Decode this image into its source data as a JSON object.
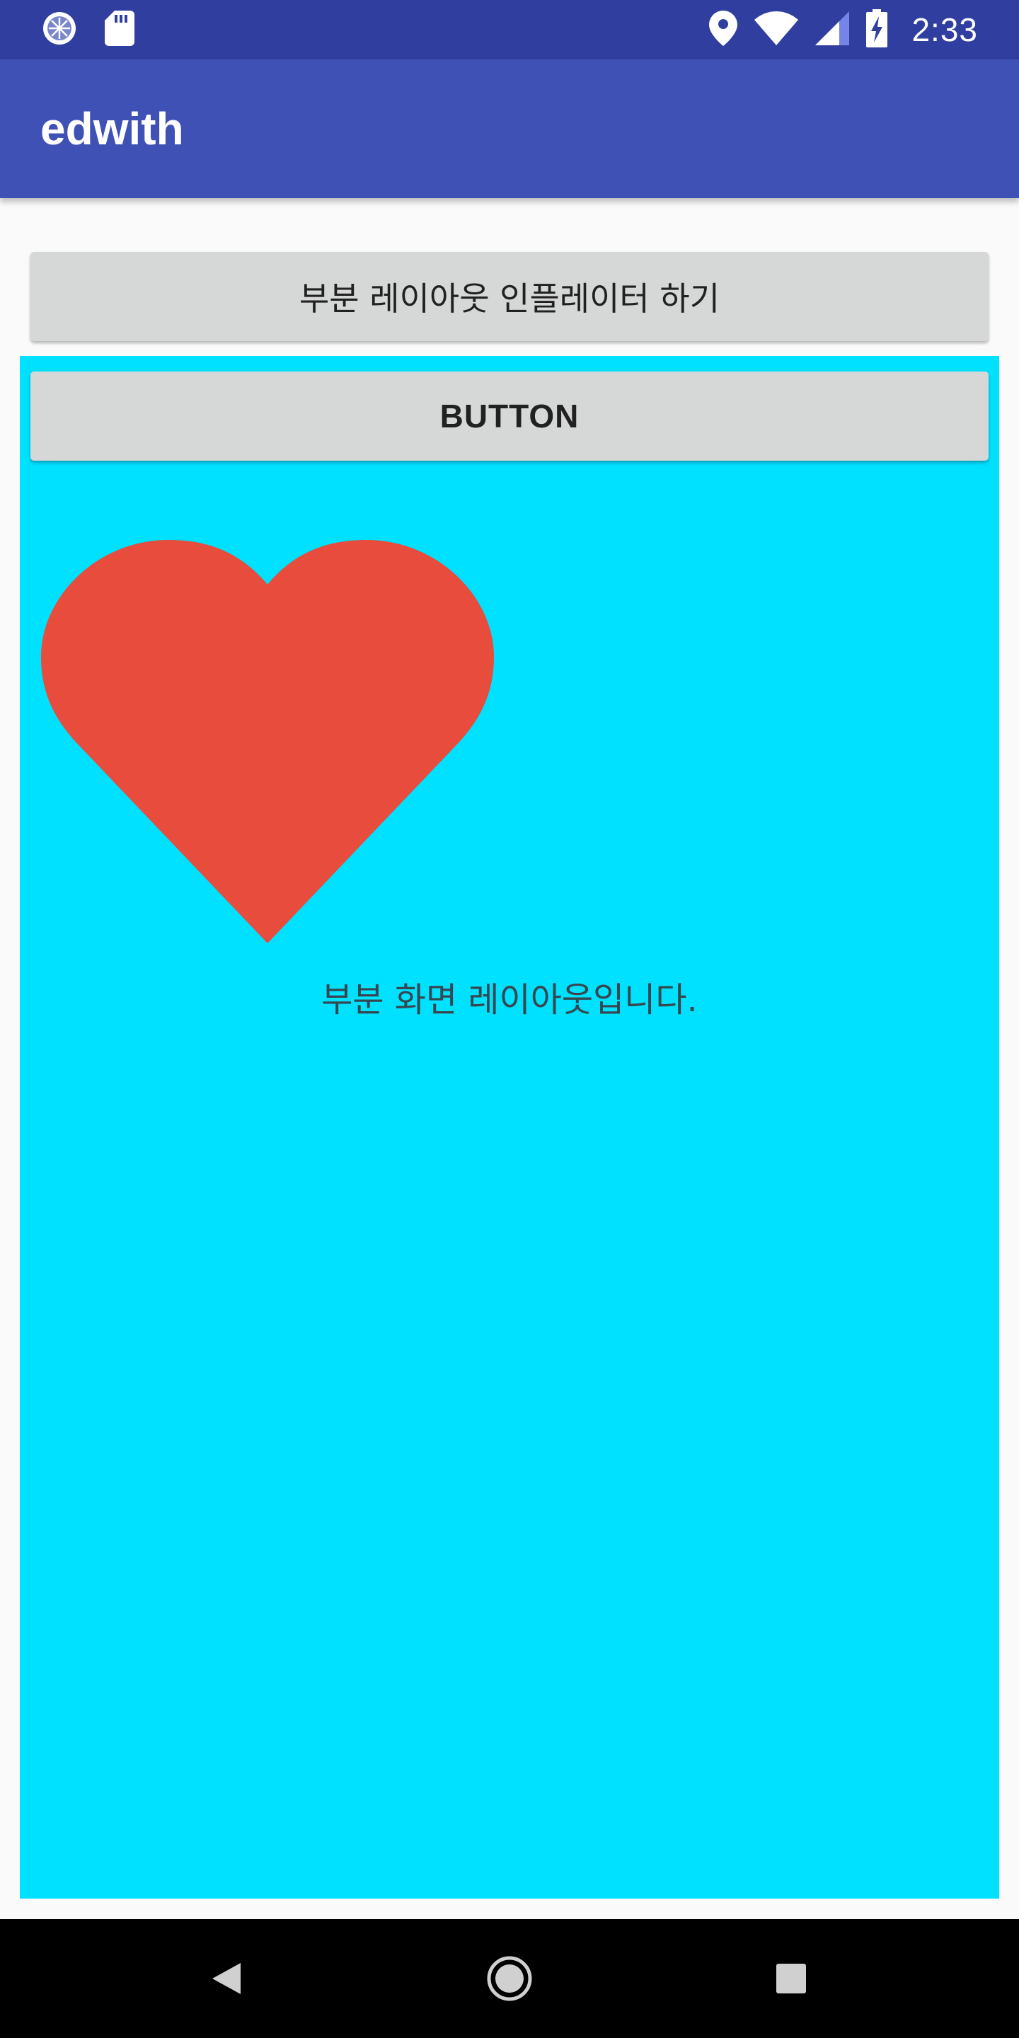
{
  "status_bar": {
    "time": "2:33",
    "icons": [
      "sync-icon",
      "sd-card-icon",
      "location-icon",
      "wifi-icon",
      "signal-icon",
      "battery-charging-icon"
    ]
  },
  "app_bar": {
    "title": "edwith"
  },
  "main": {
    "inflate_button_label": "부분 레이아웃 인플레이터 하기"
  },
  "partial_layout": {
    "background": "#00e0ff",
    "button_label": "BUTTON",
    "image_icon": "heart-icon",
    "heart_color": "#e74c3c",
    "text": "부분 화면 레이아웃입니다."
  },
  "nav_bar": {
    "icons": [
      "back-icon",
      "home-icon",
      "recents-icon"
    ]
  },
  "colors": {
    "status_bar": "#303f9f",
    "app_bar": "#3f51b5",
    "button": "#d6d7d7",
    "page_background": "#fafafa"
  }
}
